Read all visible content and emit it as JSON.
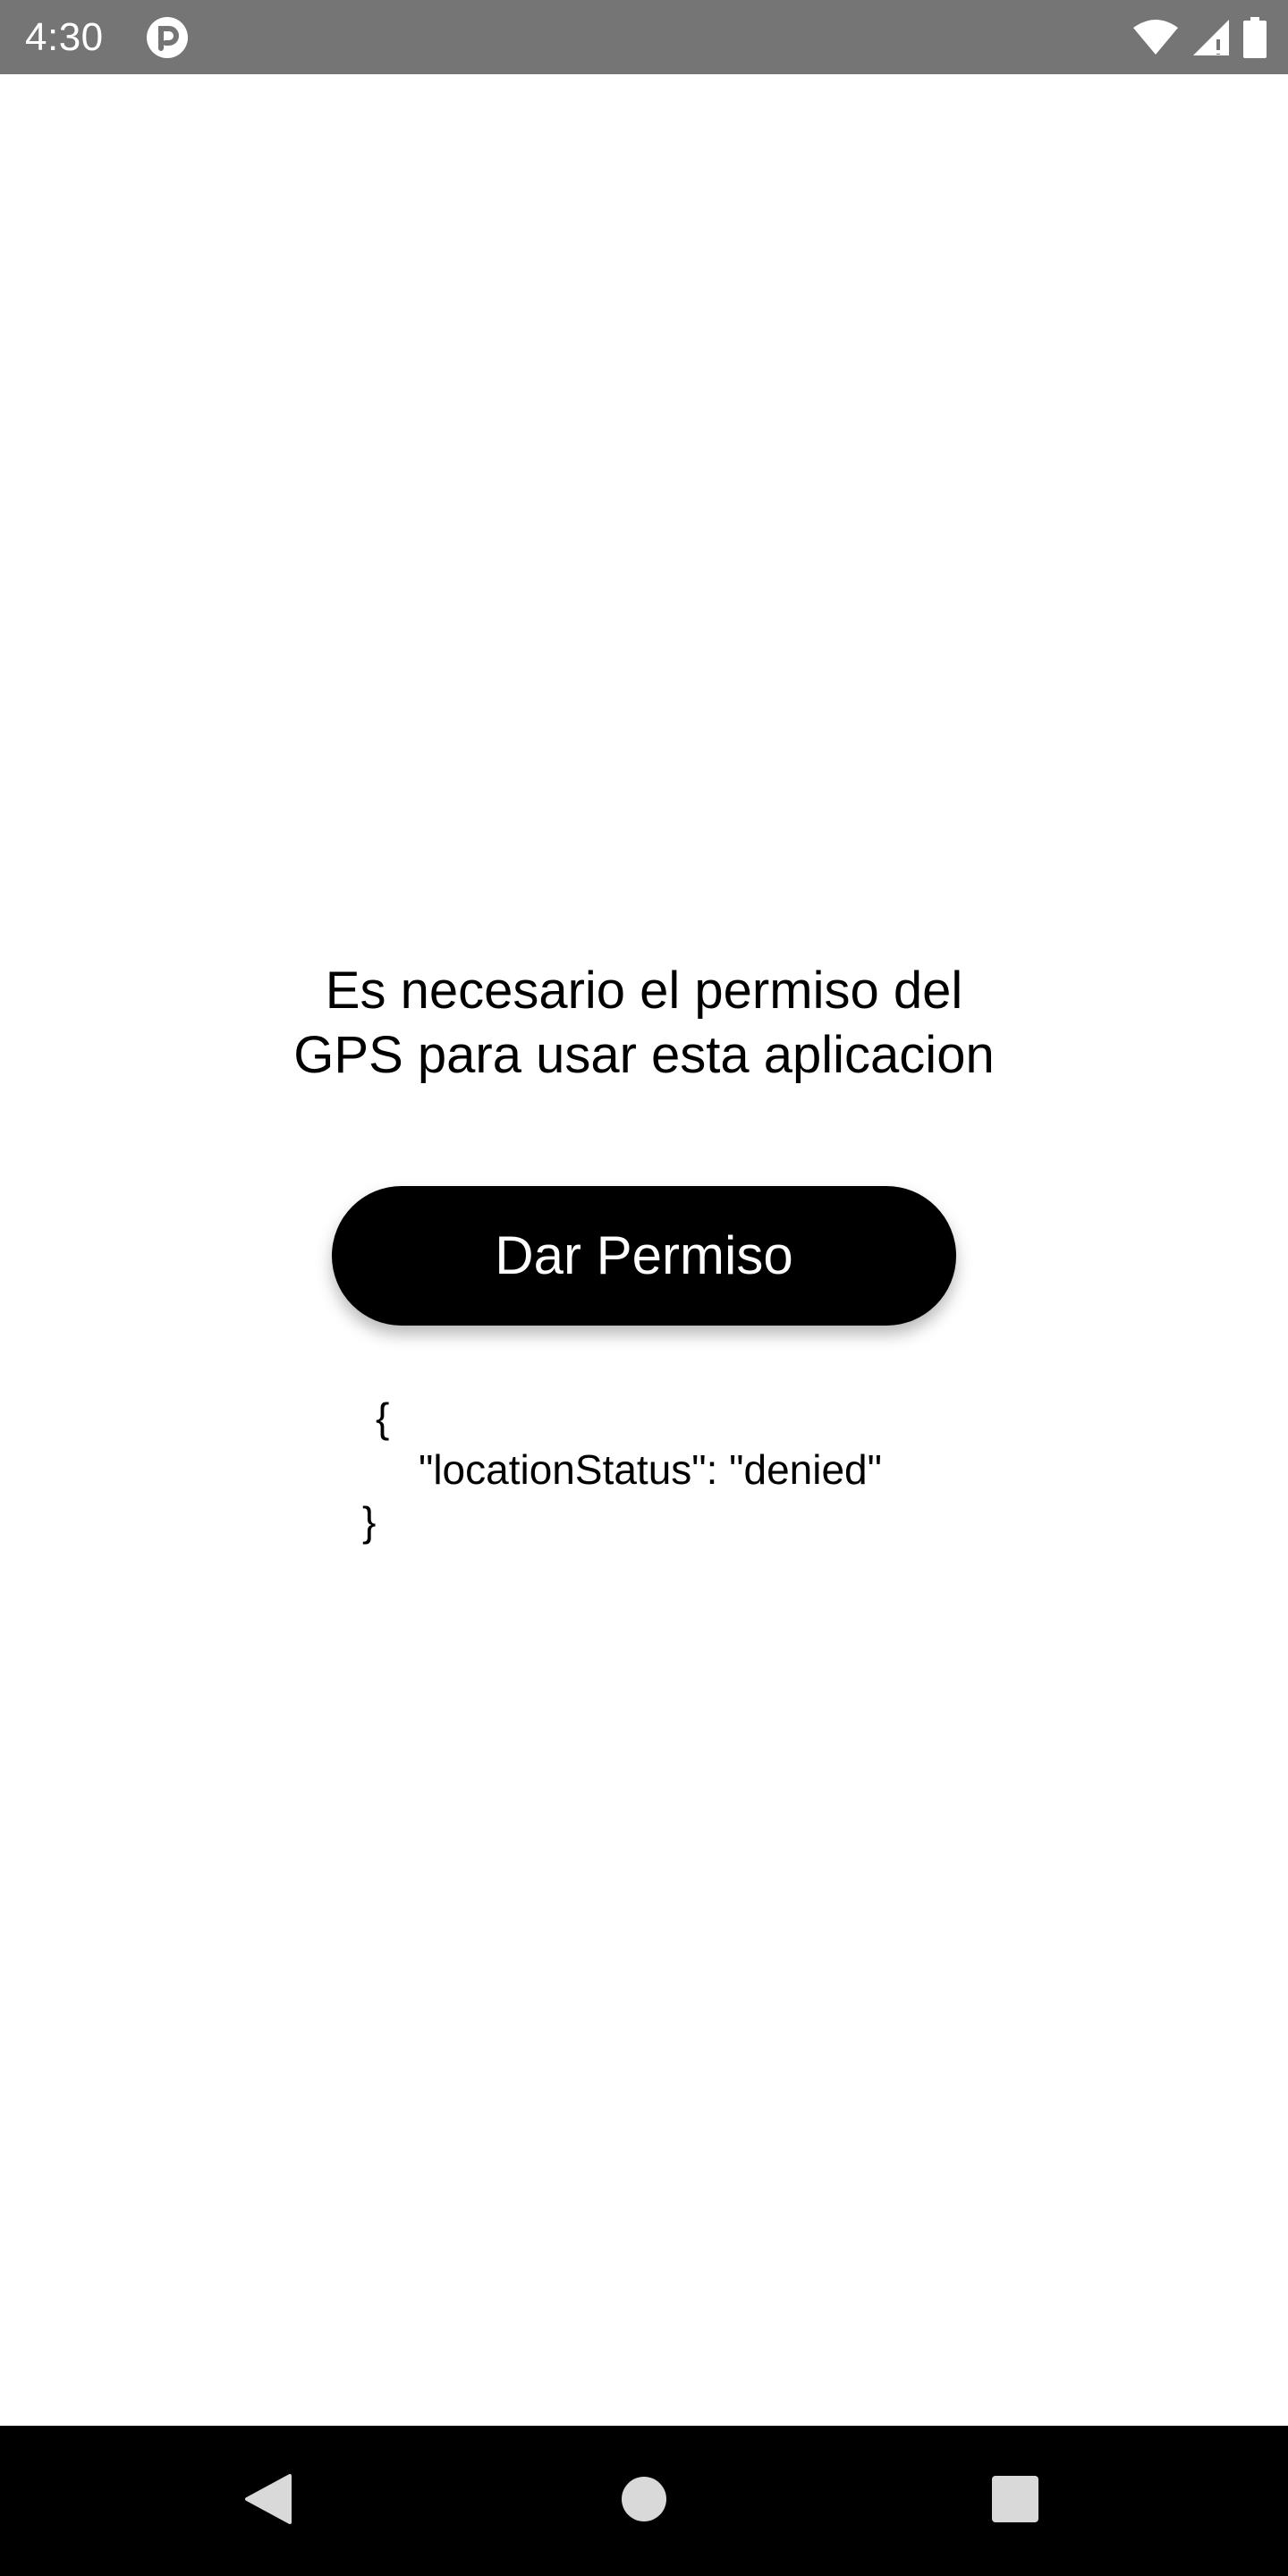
{
  "status_bar": {
    "time": "4:30",
    "app_icon": "pocket-casts-style-icon",
    "icons": [
      "wifi-icon",
      "cellular-signal-icon",
      "battery-icon"
    ],
    "background_color": "#757575"
  },
  "main": {
    "message_line1": "Es necesario el permiso del",
    "message_line2": "GPS para usar esta aplicacion",
    "button_label": "Dar Permiso",
    "button_color": "#000000",
    "json_open": "{",
    "json_content": "\"locationStatus\": \"denied\"",
    "json_close": "}"
  },
  "nav_bar": {
    "icons": [
      "back-icon",
      "home-icon",
      "recents-icon"
    ],
    "background_color": "#000000"
  }
}
